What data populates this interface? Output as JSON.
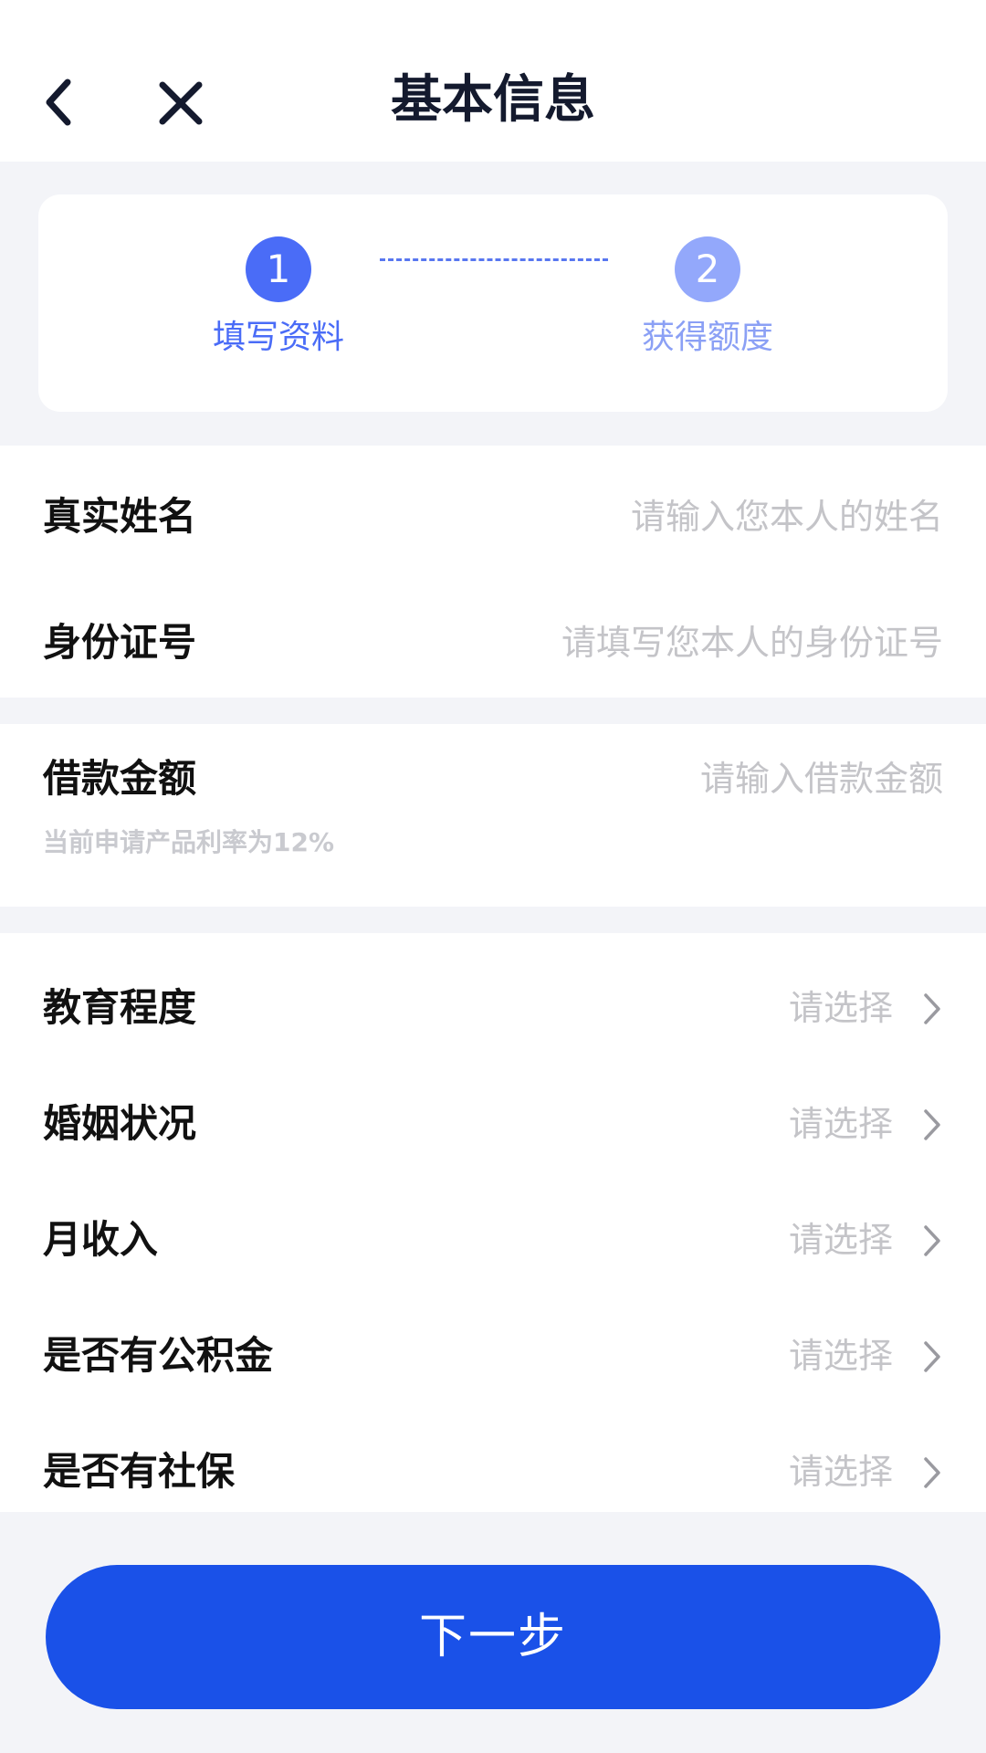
{
  "header": {
    "title": "基本信息",
    "back_icon": "chevron-left-icon",
    "close_icon": "close-icon"
  },
  "steps": [
    {
      "number": "1",
      "label": "填写资料",
      "state": "active"
    },
    {
      "number": "2",
      "label": "获得额度",
      "state": "inactive"
    }
  ],
  "identity": {
    "name": {
      "label": "真实姓名",
      "placeholder": "请输入您本人的姓名",
      "value": ""
    },
    "id_number": {
      "label": "身份证号",
      "placeholder": "请填写您本人的身份证号",
      "value": ""
    }
  },
  "loan": {
    "label": "借款金额",
    "placeholder": "请输入借款金额",
    "value": "",
    "hint": "当前申请产品利率为12%"
  },
  "selects": [
    {
      "label": "教育程度",
      "value": "请选择"
    },
    {
      "label": "婚姻状况",
      "value": "请选择"
    },
    {
      "label": "月收入",
      "value": "请选择"
    },
    {
      "label": "是否有公积金",
      "value": "请选择"
    },
    {
      "label": "是否有社保",
      "value": "请选择"
    }
  ],
  "next_button": {
    "label": "下一步"
  },
  "colors": {
    "primary": "#1a51e8",
    "step_active": "#4a6cf7",
    "step_inactive": "#93a8fb",
    "placeholder": "#c4c4c8",
    "background": "#f3f4f8"
  }
}
